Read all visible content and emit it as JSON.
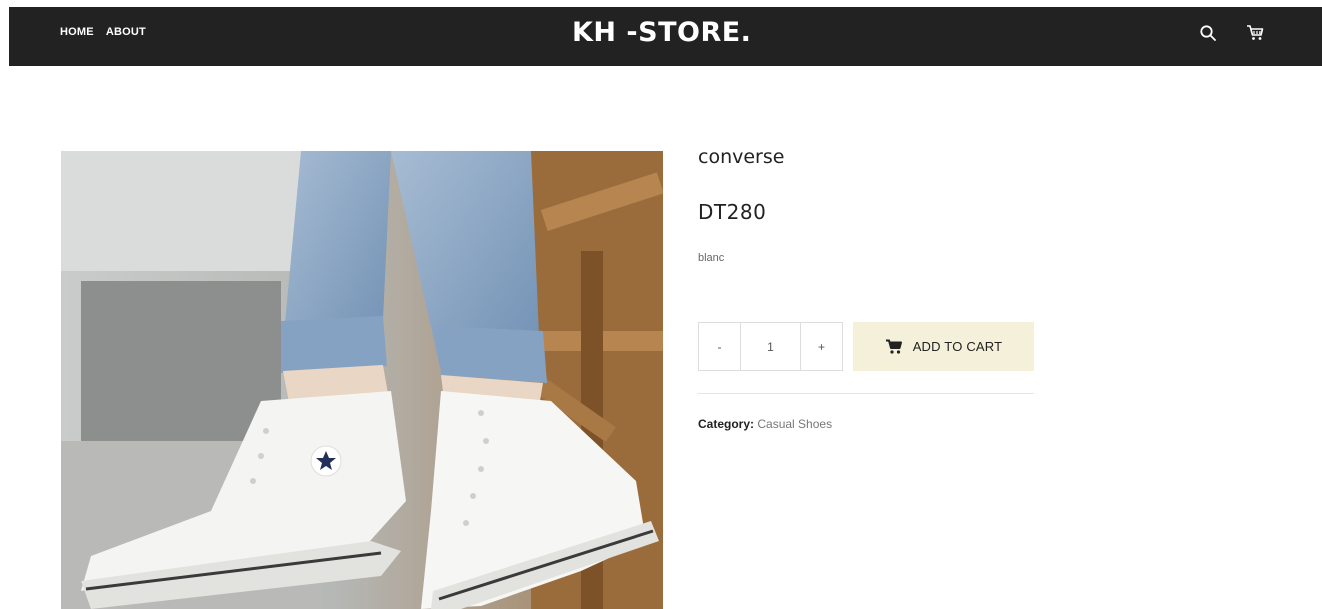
{
  "nav": {
    "home": "HOME",
    "about": "ABOUT",
    "brand": "KH -STORE.",
    "search_icon": "search-icon",
    "cart_icon": "shopping-cart-icon"
  },
  "product": {
    "brand": "converse",
    "name": "DT280",
    "color": "blanc",
    "quantity": {
      "minus": "-",
      "value": "1",
      "plus": "+"
    },
    "add_to_cart": "ADD TO CART",
    "category_label": "Category:",
    "category_value": "Casual Shoes"
  },
  "colors": {
    "topbar": "#222222",
    "add_to_cart_bg": "#f5f0d9"
  }
}
